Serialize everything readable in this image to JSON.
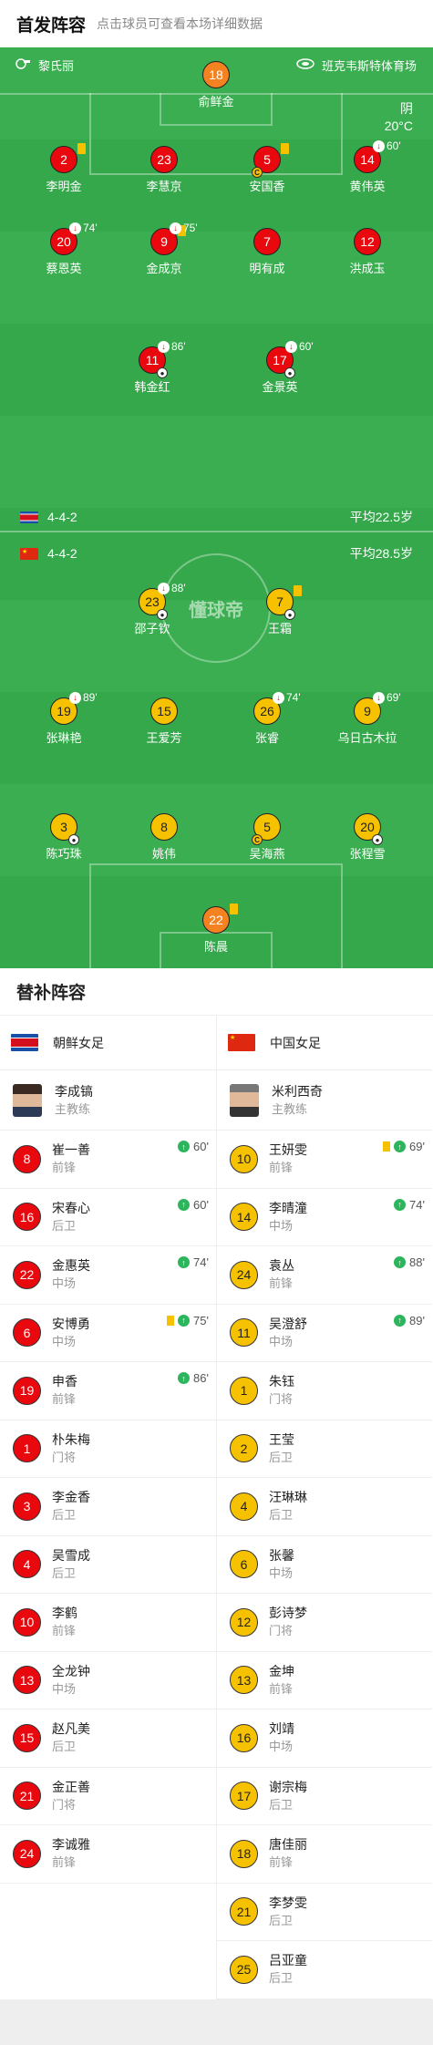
{
  "header": {
    "title": "首发阵容",
    "hint": "点击球员可查看本场详细数据"
  },
  "match": {
    "home_team": "黎氏丽",
    "venue": "班克韦斯特体育场",
    "weather": "阴",
    "temperature": "20°C"
  },
  "teams": {
    "nk": {
      "formation": "4-4-2",
      "avg_age": "平均22.5岁"
    },
    "cn": {
      "formation": "4-4-2",
      "avg_age": "平均28.5岁"
    }
  },
  "watermark": "懂球帝",
  "pitch_players": [
    {
      "num": "18",
      "name": "俞鲜金",
      "color": "orange"
    },
    {
      "num": "2",
      "name": "李明金",
      "color": "red",
      "yellow": true
    },
    {
      "num": "23",
      "name": "李慧京",
      "color": "red"
    },
    {
      "num": "5",
      "name": "安国香",
      "color": "red",
      "yellow": true,
      "captain": true
    },
    {
      "num": "14",
      "name": "黄伟英",
      "color": "red",
      "sub": "60'"
    },
    {
      "num": "20",
      "name": "蔡恩英",
      "color": "red",
      "sub": "74'"
    },
    {
      "num": "9",
      "name": "金成京",
      "color": "red",
      "yellow": true,
      "sub": "75'"
    },
    {
      "num": "7",
      "name": "明有成",
      "color": "red"
    },
    {
      "num": "12",
      "name": "洪成玉",
      "color": "red"
    },
    {
      "num": "11",
      "name": "韩金红",
      "color": "red",
      "sub": "86'",
      "ball": true
    },
    {
      "num": "17",
      "name": "金景英",
      "color": "red",
      "sub": "60'",
      "ball": true
    },
    {
      "num": "23",
      "name": "邵子钦",
      "color": "yellow",
      "sub": "88'",
      "ball": true
    },
    {
      "num": "7",
      "name": "王霜",
      "color": "yellow",
      "yellow": true,
      "ball": true
    },
    {
      "num": "19",
      "name": "张琳艳",
      "color": "yellow",
      "sub": "89'"
    },
    {
      "num": "15",
      "name": "王爱芳",
      "color": "yellow"
    },
    {
      "num": "26",
      "name": "张睿",
      "color": "yellow",
      "sub": "74'"
    },
    {
      "num": "9",
      "name": "乌日古木拉",
      "color": "yellow",
      "sub": "69'"
    },
    {
      "num": "3",
      "name": "陈巧珠",
      "color": "yellow",
      "ball": true
    },
    {
      "num": "8",
      "name": "姚伟",
      "color": "yellow"
    },
    {
      "num": "5",
      "name": "吴海燕",
      "color": "yellow",
      "captain": true
    },
    {
      "num": "20",
      "name": "张程雪",
      "color": "yellow",
      "ball": true
    },
    {
      "num": "22",
      "name": "陈晨",
      "color": "orange",
      "yellow": true
    }
  ],
  "subs": {
    "title": "替补阵容",
    "left": {
      "team": "朝鲜女足",
      "coach": "李成镐",
      "coach_role": "主教练",
      "players": [
        {
          "num": "8",
          "name": "崔一善",
          "pos": "前锋",
          "sub": "60'"
        },
        {
          "num": "16",
          "name": "宋春心",
          "pos": "后卫",
          "sub": "60'"
        },
        {
          "num": "22",
          "name": "金惠英",
          "pos": "中场",
          "sub": "74'"
        },
        {
          "num": "6",
          "name": "安博勇",
          "pos": "中场",
          "sub": "75'",
          "yellow": true
        },
        {
          "num": "19",
          "name": "申香",
          "pos": "前锋",
          "sub": "86'"
        },
        {
          "num": "1",
          "name": "朴朱梅",
          "pos": "门将"
        },
        {
          "num": "3",
          "name": "李金香",
          "pos": "后卫"
        },
        {
          "num": "4",
          "name": "吴雪成",
          "pos": "后卫"
        },
        {
          "num": "10",
          "name": "李鹤",
          "pos": "前锋"
        },
        {
          "num": "13",
          "name": "全龙钟",
          "pos": "中场"
        },
        {
          "num": "15",
          "name": "赵凡美",
          "pos": "后卫"
        },
        {
          "num": "21",
          "name": "金正善",
          "pos": "门将"
        },
        {
          "num": "24",
          "name": "李诚雅",
          "pos": "前锋"
        }
      ]
    },
    "right": {
      "team": "中国女足",
      "coach": "米利西奇",
      "coach_role": "主教练",
      "players": [
        {
          "num": "10",
          "name": "王妍雯",
          "pos": "前锋",
          "sub": "69'",
          "yellow": true
        },
        {
          "num": "14",
          "name": "李晴潼",
          "pos": "中场",
          "sub": "74'"
        },
        {
          "num": "24",
          "name": "袁丛",
          "pos": "前锋",
          "sub": "88'"
        },
        {
          "num": "11",
          "name": "吴澄舒",
          "pos": "中场",
          "sub": "89'"
        },
        {
          "num": "1",
          "name": "朱钰",
          "pos": "门将"
        },
        {
          "num": "2",
          "name": "王莹",
          "pos": "后卫"
        },
        {
          "num": "4",
          "name": "汪琳琳",
          "pos": "后卫"
        },
        {
          "num": "6",
          "name": "张馨",
          "pos": "中场"
        },
        {
          "num": "12",
          "name": "彭诗梦",
          "pos": "门将"
        },
        {
          "num": "13",
          "name": "金坤",
          "pos": "前锋"
        },
        {
          "num": "16",
          "name": "刘靖",
          "pos": "中场"
        },
        {
          "num": "17",
          "name": "谢宗梅",
          "pos": "后卫"
        },
        {
          "num": "18",
          "name": "唐佳丽",
          "pos": "前锋"
        },
        {
          "num": "21",
          "name": "李梦雯",
          "pos": "后卫"
        },
        {
          "num": "25",
          "name": "吕亚童",
          "pos": "后卫"
        }
      ]
    }
  },
  "colors": {
    "pitch": "#36a84c",
    "red_team": "#e8080e",
    "cn_team": "#f6c200",
    "keeper": "#f58220"
  }
}
